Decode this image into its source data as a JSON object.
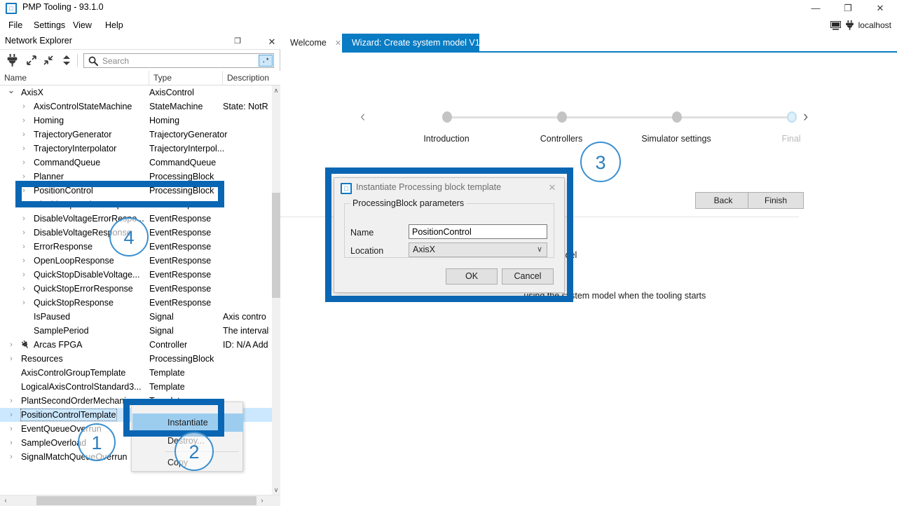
{
  "window": {
    "title": "PMP Tooling - 93.1.0",
    "icon": "app-icon",
    "minimize": "—",
    "maximize": "❐",
    "close": "✕"
  },
  "menubar": {
    "items": [
      {
        "label": "File"
      },
      {
        "label": "Settings"
      },
      {
        "label": "View"
      },
      {
        "label": "Help"
      }
    ]
  },
  "connection": {
    "host": "localhost",
    "monitor_icon": "monitor-icon",
    "plug_icon": "plug-icon"
  },
  "explorer": {
    "title": "Network Explorer",
    "float_icon": "❐",
    "close_icon": "✕",
    "toolbar": {
      "connect_icon": "plug-icon",
      "expand_icon": "expand-arrows-icon",
      "collapse_icon": "collapse-arrows-icon",
      "sort_icon": "sort-updown-icon"
    },
    "search": {
      "placeholder": "Search",
      "value": "",
      "icon": "search-icon",
      "regex_label": ".*"
    },
    "columns": [
      "Name",
      "Type",
      "Description"
    ],
    "scroll": {
      "up": "∧",
      "down": "∨",
      "left": "‹",
      "right": "›"
    },
    "rows": [
      {
        "name": "AxisX",
        "type": "AxisControl",
        "desc": "",
        "depth": 1,
        "arrow": "open"
      },
      {
        "name": "AxisControlStateMachine",
        "type": "StateMachine",
        "desc": "State: NotR",
        "depth": 2,
        "arrow": "closed"
      },
      {
        "name": "Homing",
        "type": "Homing",
        "desc": "",
        "depth": 2,
        "arrow": "closed"
      },
      {
        "name": "TrajectoryGenerator",
        "type": "TrajectoryGenerator",
        "desc": "",
        "depth": 2,
        "arrow": "closed"
      },
      {
        "name": "TrajectoryInterpolator",
        "type": "TrajectoryInterpol...",
        "desc": "",
        "depth": 2,
        "arrow": "closed"
      },
      {
        "name": "CommandQueue",
        "type": "CommandQueue",
        "desc": "",
        "depth": 2,
        "arrow": "closed"
      },
      {
        "name": "Planner",
        "type": "ProcessingBlock",
        "desc": "",
        "depth": 2,
        "arrow": "closed"
      },
      {
        "name": "PositionControl",
        "type": "ProcessingBlock",
        "desc": "",
        "depth": 2,
        "arrow": "closed"
      },
      {
        "name": "DisableOperationResponse",
        "type": "EventResponse",
        "desc": "",
        "depth": 2,
        "arrow": "closed"
      },
      {
        "name": "DisableVoltageErrorRespo...",
        "type": "EventResponse",
        "desc": "",
        "depth": 2,
        "arrow": "closed"
      },
      {
        "name": "DisableVoltageResponse",
        "type": "EventResponse",
        "desc": "",
        "depth": 2,
        "arrow": "closed"
      },
      {
        "name": "ErrorResponse",
        "type": "EventResponse",
        "desc": "",
        "depth": 2,
        "arrow": "closed"
      },
      {
        "name": "OpenLoopResponse",
        "type": "EventResponse",
        "desc": "",
        "depth": 2,
        "arrow": "closed"
      },
      {
        "name": "QuickStopDisableVoltage...",
        "type": "EventResponse",
        "desc": "",
        "depth": 2,
        "arrow": "closed"
      },
      {
        "name": "QuickStopErrorResponse",
        "type": "EventResponse",
        "desc": "",
        "depth": 2,
        "arrow": "closed"
      },
      {
        "name": "QuickStopResponse",
        "type": "EventResponse",
        "desc": "",
        "depth": 2,
        "arrow": "closed"
      },
      {
        "name": "IsPaused",
        "type": "Signal",
        "desc": "Axis contro",
        "depth": 2,
        "arrow": "none"
      },
      {
        "name": "SamplePeriod",
        "type": "Signal",
        "desc": "The interval",
        "depth": 2,
        "arrow": "none"
      },
      {
        "name": "Arcas FPGA",
        "type": "Controller",
        "desc": "ID: N/A Add",
        "depth": 1,
        "arrow": "closed",
        "icon": "fpga-plug-icon"
      },
      {
        "name": "Resources",
        "type": "ProcessingBlock",
        "desc": "",
        "depth": 1,
        "arrow": "closed"
      },
      {
        "name": "AxisControlGroupTemplate",
        "type": "Template",
        "desc": "",
        "depth": 1,
        "arrow": "none"
      },
      {
        "name": "LogicalAxisControlStandard3...",
        "type": "Template",
        "desc": "",
        "depth": 1,
        "arrow": "none"
      },
      {
        "name": "PlantSecondOrderMechanica...",
        "type": "Template",
        "desc": "",
        "depth": 1,
        "arrow": "closed"
      },
      {
        "name": "PositionControlTemplate",
        "type": "Template",
        "desc": "",
        "depth": 1,
        "arrow": "closed",
        "selected": true
      },
      {
        "name": "EventQueueOverrun",
        "type": "",
        "desc": "",
        "depth": 1,
        "arrow": "closed"
      },
      {
        "name": "SampleOverload",
        "type": "",
        "desc": "",
        "depth": 1,
        "arrow": "closed"
      },
      {
        "name": "SignalMatchQueueOverrun",
        "type": "",
        "desc": "",
        "depth": 1,
        "arrow": "closed"
      }
    ]
  },
  "context_menu": {
    "items": [
      {
        "label": "Instantiate",
        "highlighted": true
      },
      {
        "label": "Destroy..."
      },
      {
        "label": "Copy"
      }
    ]
  },
  "tabs": [
    {
      "label": "Welcome",
      "close": "✕",
      "active": false
    },
    {
      "label": "Wizard: Create system model V1",
      "close": "✕",
      "active": true
    }
  ],
  "wizard": {
    "prev_arrow": "‹",
    "next_arrow": "›",
    "steps": [
      {
        "label": "Introduction"
      },
      {
        "label": "Controllers"
      },
      {
        "label": "Simulator settings"
      },
      {
        "label": "Final"
      }
    ],
    "buttons": {
      "back": "Back",
      "finish": "Finish"
    },
    "page_title": "Final",
    "line1": "...em model",
    "line2": "...using the system model when the tooling starts"
  },
  "dialog": {
    "title": "Instantiate Processing block template",
    "icon": "app-icon",
    "close": "✕",
    "group_label": "ProcessingBlock parameters",
    "fields": [
      {
        "label": "Name",
        "value": "PositionControl",
        "type": "text"
      },
      {
        "label": "Location",
        "value": "AxisX",
        "type": "select",
        "chevron": "∨"
      }
    ],
    "buttons": {
      "ok": "OK",
      "cancel": "Cancel"
    }
  },
  "annotations": {
    "markers": [
      {
        "id": "1",
        "label": "1"
      },
      {
        "id": "2",
        "label": "2"
      },
      {
        "id": "3",
        "label": "3"
      },
      {
        "id": "4",
        "label": "4"
      }
    ],
    "highlight_color": "#0a66b3",
    "marker_color": "#2e7ebd"
  }
}
